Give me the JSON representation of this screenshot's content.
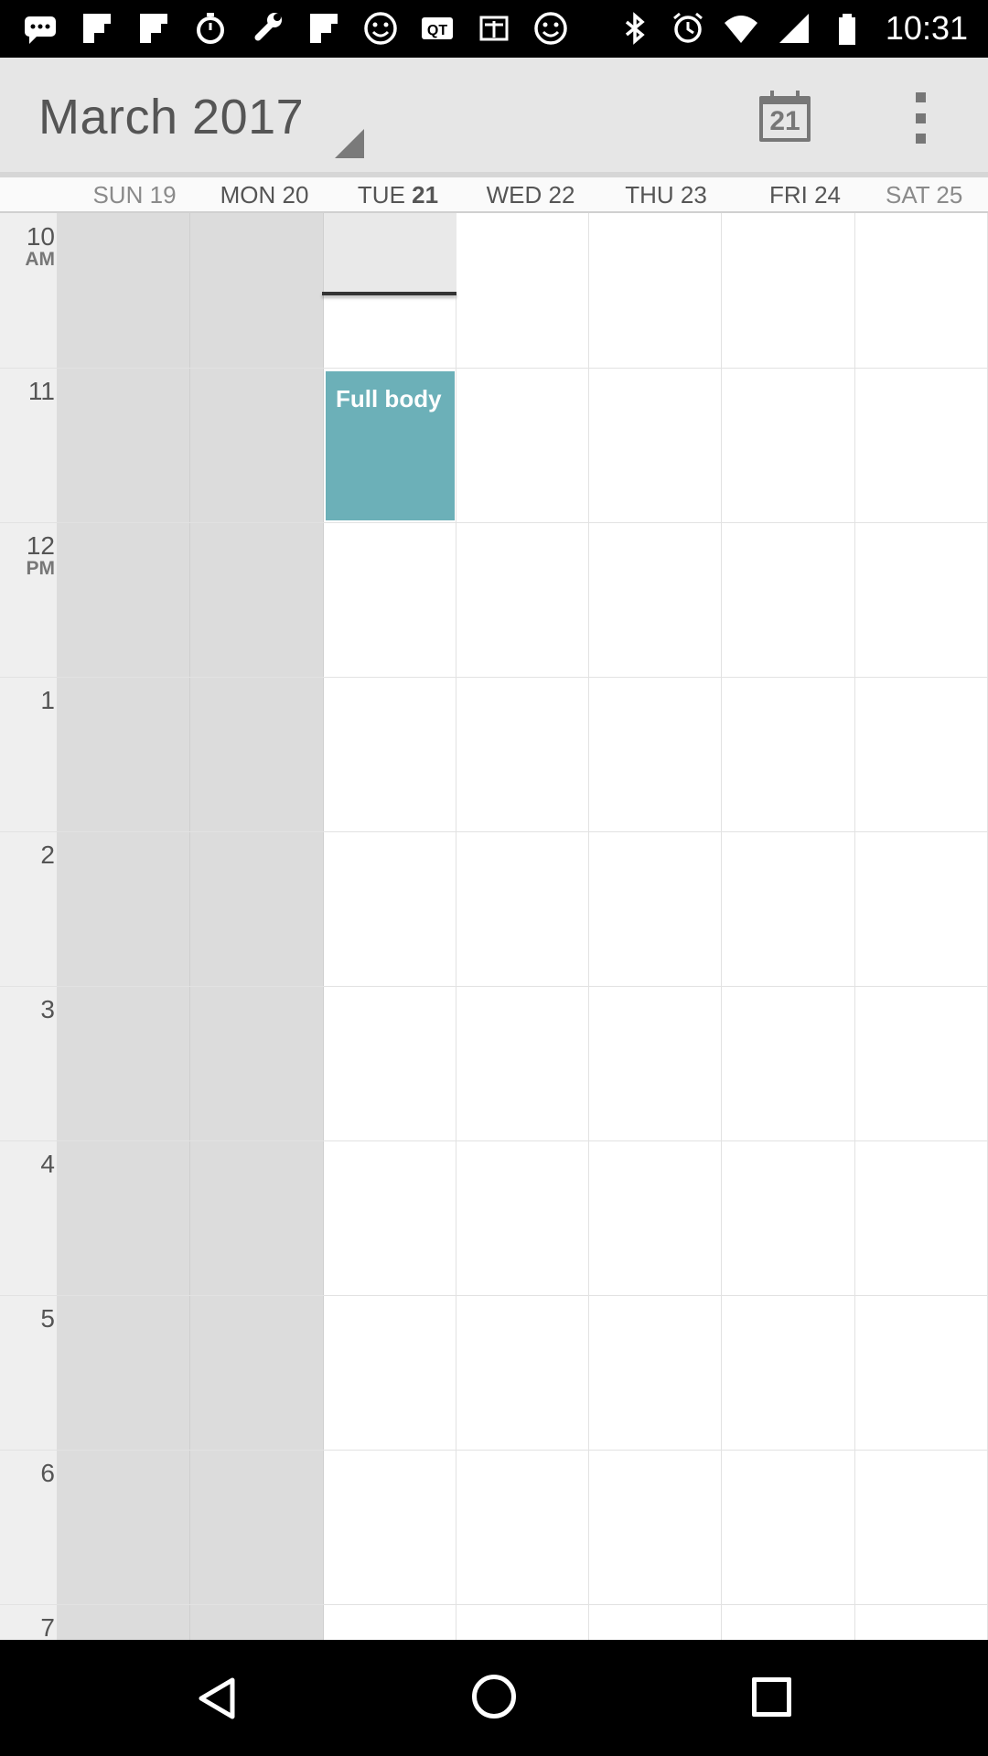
{
  "status_bar": {
    "left_icons": [
      "chat-bubble-icon",
      "flipboard-icon",
      "flipboard-icon",
      "stopwatch-icon",
      "wrench-icon",
      "flipboard-icon",
      "smiley-icon",
      "qt-icon",
      "taobao-icon",
      "smiley-icon"
    ],
    "right_icons": [
      "bluetooth-icon",
      "alarm-icon",
      "wifi-icon",
      "signal-icon",
      "battery-icon"
    ],
    "time": "10:31"
  },
  "app_bar": {
    "title": "March 2017",
    "today_number": "21",
    "icons": [
      "calendar-today-icon",
      "more-vert-icon"
    ]
  },
  "days": [
    {
      "dow": "SUN",
      "num": "19",
      "state": "past-weekend"
    },
    {
      "dow": "MON",
      "num": "20",
      "state": "past"
    },
    {
      "dow": "TUE",
      "num": "21",
      "state": "today"
    },
    {
      "dow": "WED",
      "num": "22",
      "state": "future"
    },
    {
      "dow": "THU",
      "num": "23",
      "state": "future"
    },
    {
      "dow": "FRI",
      "num": "24",
      "state": "future"
    },
    {
      "dow": "SAT",
      "num": "25",
      "state": "future-weekend"
    }
  ],
  "hours": [
    {
      "label": "10",
      "ampm": "AM"
    },
    {
      "label": "11",
      "ampm": ""
    },
    {
      "label": "12",
      "ampm": "PM"
    },
    {
      "label": "1",
      "ampm": ""
    },
    {
      "label": "2",
      "ampm": ""
    },
    {
      "label": "3",
      "ampm": ""
    },
    {
      "label": "4",
      "ampm": ""
    },
    {
      "label": "5",
      "ampm": ""
    },
    {
      "label": "6",
      "ampm": ""
    },
    {
      "label": "7",
      "ampm": ""
    }
  ],
  "events": [
    {
      "title": "Full body",
      "day": "TUE 21",
      "start": "11",
      "color": "#6cb0b8"
    }
  ],
  "colors": {
    "event": "#6cb0b8",
    "past_day": "#dcdcdc",
    "app_bar": "#e6e6e6"
  },
  "nav_bar": {
    "icons": [
      "back-icon",
      "home-icon",
      "recents-icon"
    ]
  }
}
